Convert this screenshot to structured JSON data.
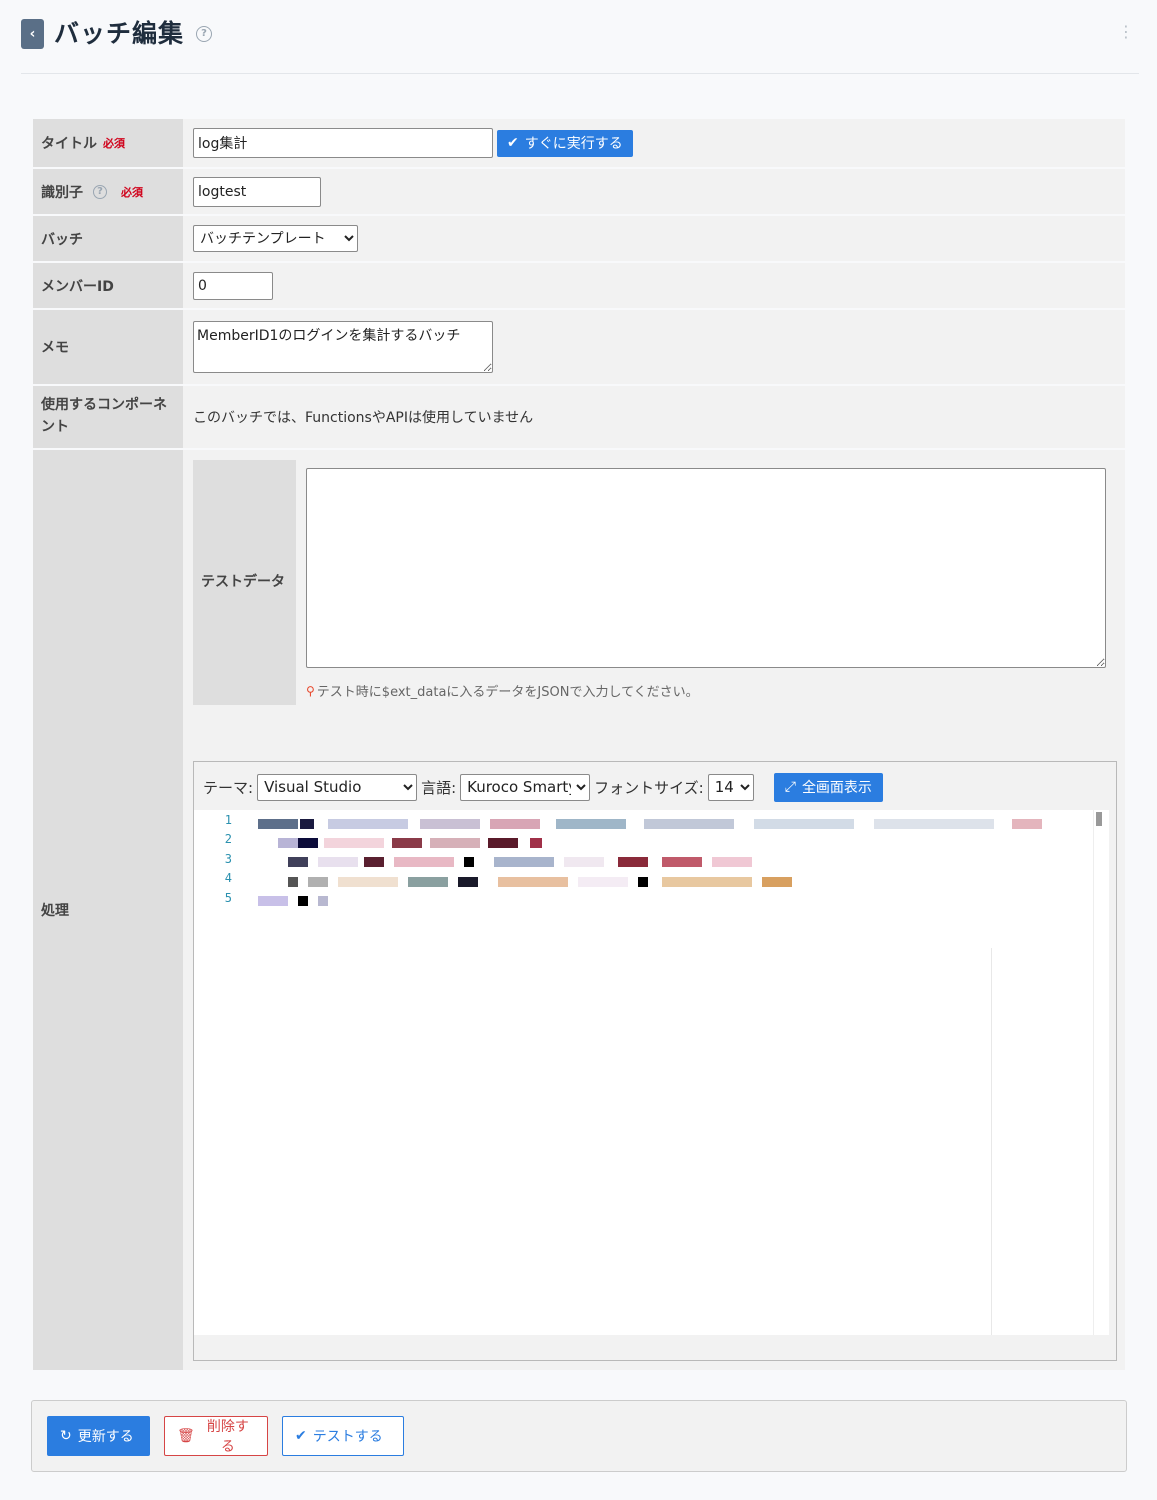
{
  "header": {
    "title": "バッチ編集",
    "back_icon": "chevron-left-icon",
    "help_icon": "question-circle-icon",
    "menu_icon": "kebab-menu-icon"
  },
  "form": {
    "title": {
      "label": "タイトル",
      "required": "必須",
      "value": "log集計",
      "run_button": "すぐに実行する"
    },
    "identifier": {
      "label": "識別子",
      "required": "必須",
      "value": "logtest"
    },
    "batch": {
      "label": "バッチ",
      "selected": "バッチテンプレート"
    },
    "member_id": {
      "label": "メンバーID",
      "value": "0"
    },
    "memo": {
      "label": "メモ",
      "value": "MemberID1のログインを集計するバッチ"
    },
    "components": {
      "label": "使用するコンポーネント",
      "value": "このバッチでは、FunctionsやAPIは使用していません"
    },
    "processing": {
      "label": "処理",
      "test_data": {
        "label": "テストデータ",
        "value": "",
        "hint": "テスト時に$ext_dataに入るデータをJSONで入力してください。"
      },
      "editor": {
        "theme_label": "テーマ:",
        "theme_value": "Visual Studio",
        "language_label": "言語:",
        "language_value": "Kuroco Smarty",
        "font_size_label": "フォントサイズ:",
        "font_size_value": "14",
        "fullscreen_button": "全画面表示",
        "line_numbers": [
          "1",
          "2",
          "3",
          "4",
          "5"
        ]
      }
    }
  },
  "footer": {
    "update_button": "更新する",
    "delete_button": "削除する",
    "test_button": "テストする"
  },
  "colors": {
    "accent": "#2b7de0",
    "danger": "#d64545",
    "required": "#d0021b",
    "label_bg": "#dedede",
    "value_bg": "#f2f2f2"
  }
}
